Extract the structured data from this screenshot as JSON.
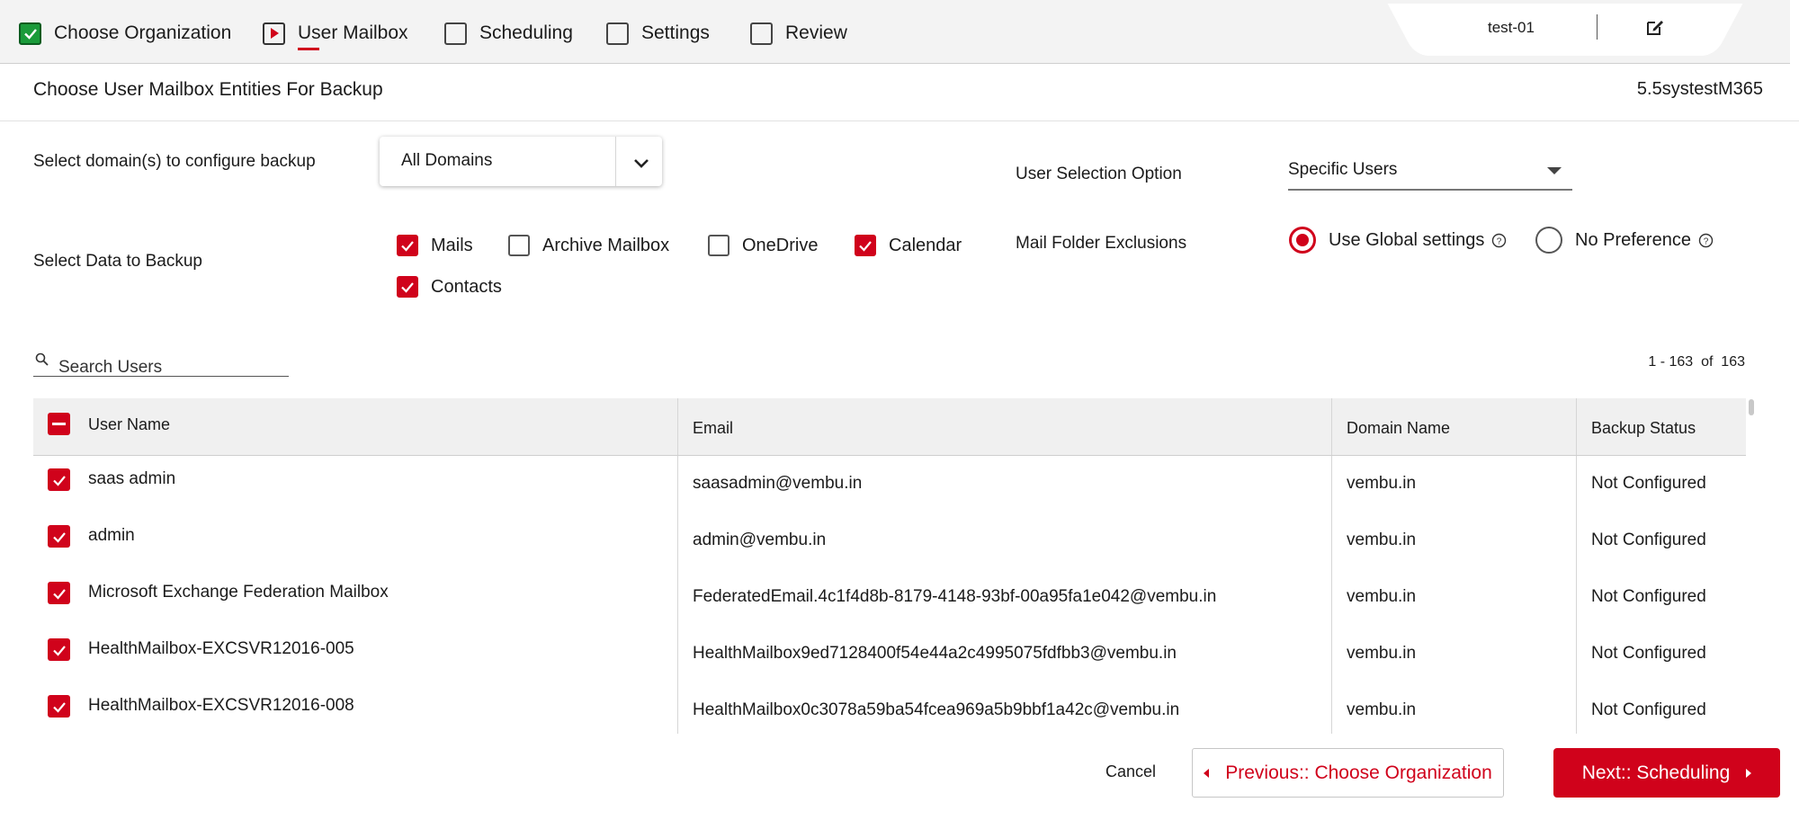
{
  "wizard": {
    "steps": [
      {
        "label": "Choose Organization",
        "state": "done"
      },
      {
        "label": "User Mailbox",
        "state": "active"
      },
      {
        "label": "Scheduling",
        "state": "pending"
      },
      {
        "label": "Settings",
        "state": "pending"
      },
      {
        "label": "Review",
        "state": "pending"
      }
    ],
    "plan_name": "test-01"
  },
  "header": {
    "title": "Choose User Mailbox Entities For Backup",
    "organization": "5.5systestM365"
  },
  "form": {
    "domain_label": "Select domain(s) to configure backup",
    "domain_value": "All Domains",
    "user_selection_label": "User Selection Option",
    "user_selection_value": "Specific Users",
    "data_label": "Select Data to Backup",
    "data_options": [
      {
        "label": "Mails",
        "checked": true
      },
      {
        "label": "Archive Mailbox",
        "checked": false
      },
      {
        "label": "OneDrive",
        "checked": false
      },
      {
        "label": "Calendar",
        "checked": true
      },
      {
        "label": "Contacts",
        "checked": true
      }
    ],
    "exclusions_label": "Mail Folder Exclusions",
    "exclusion_options": [
      {
        "label": "Use Global settings",
        "selected": true
      },
      {
        "label": "No Preference",
        "selected": false
      }
    ]
  },
  "search": {
    "placeholder": "Search Users"
  },
  "pager": {
    "text": "1 - 163  of  163"
  },
  "table": {
    "columns": [
      "User Name",
      "Email",
      "Domain Name",
      "Backup Status"
    ],
    "rows": [
      {
        "name": "saas admin",
        "email": "saasadmin@vembu.in",
        "domain": "vembu.in",
        "status": "Not Configured",
        "checked": true
      },
      {
        "name": "admin",
        "email": "admin@vembu.in",
        "domain": "vembu.in",
        "status": "Not Configured",
        "checked": true
      },
      {
        "name": "Microsoft Exchange Federation Mailbox",
        "email": "FederatedEmail.4c1f4d8b-8179-4148-93bf-00a95fa1e042@vembu.in",
        "domain": "vembu.in",
        "status": "Not Configured",
        "checked": true
      },
      {
        "name": "HealthMailbox-EXCSVR12016-005",
        "email": "HealthMailbox9ed7128400f54e44a2c4995075fdfbb3@vembu.in",
        "domain": "vembu.in",
        "status": "Not Configured",
        "checked": true
      },
      {
        "name": "HealthMailbox-EXCSVR12016-008",
        "email": "HealthMailbox0c3078a59ba54fcea969a5b9bbf1a42c@vembu.in",
        "domain": "vembu.in",
        "status": "Not Configured",
        "checked": true
      }
    ]
  },
  "footer": {
    "cancel_label": "Cancel",
    "prev_label": "Previous:: Choose Organization",
    "next_label": "Next:: Scheduling"
  },
  "colors": {
    "accent": "#d0021b",
    "done": "#1a9b3a"
  }
}
